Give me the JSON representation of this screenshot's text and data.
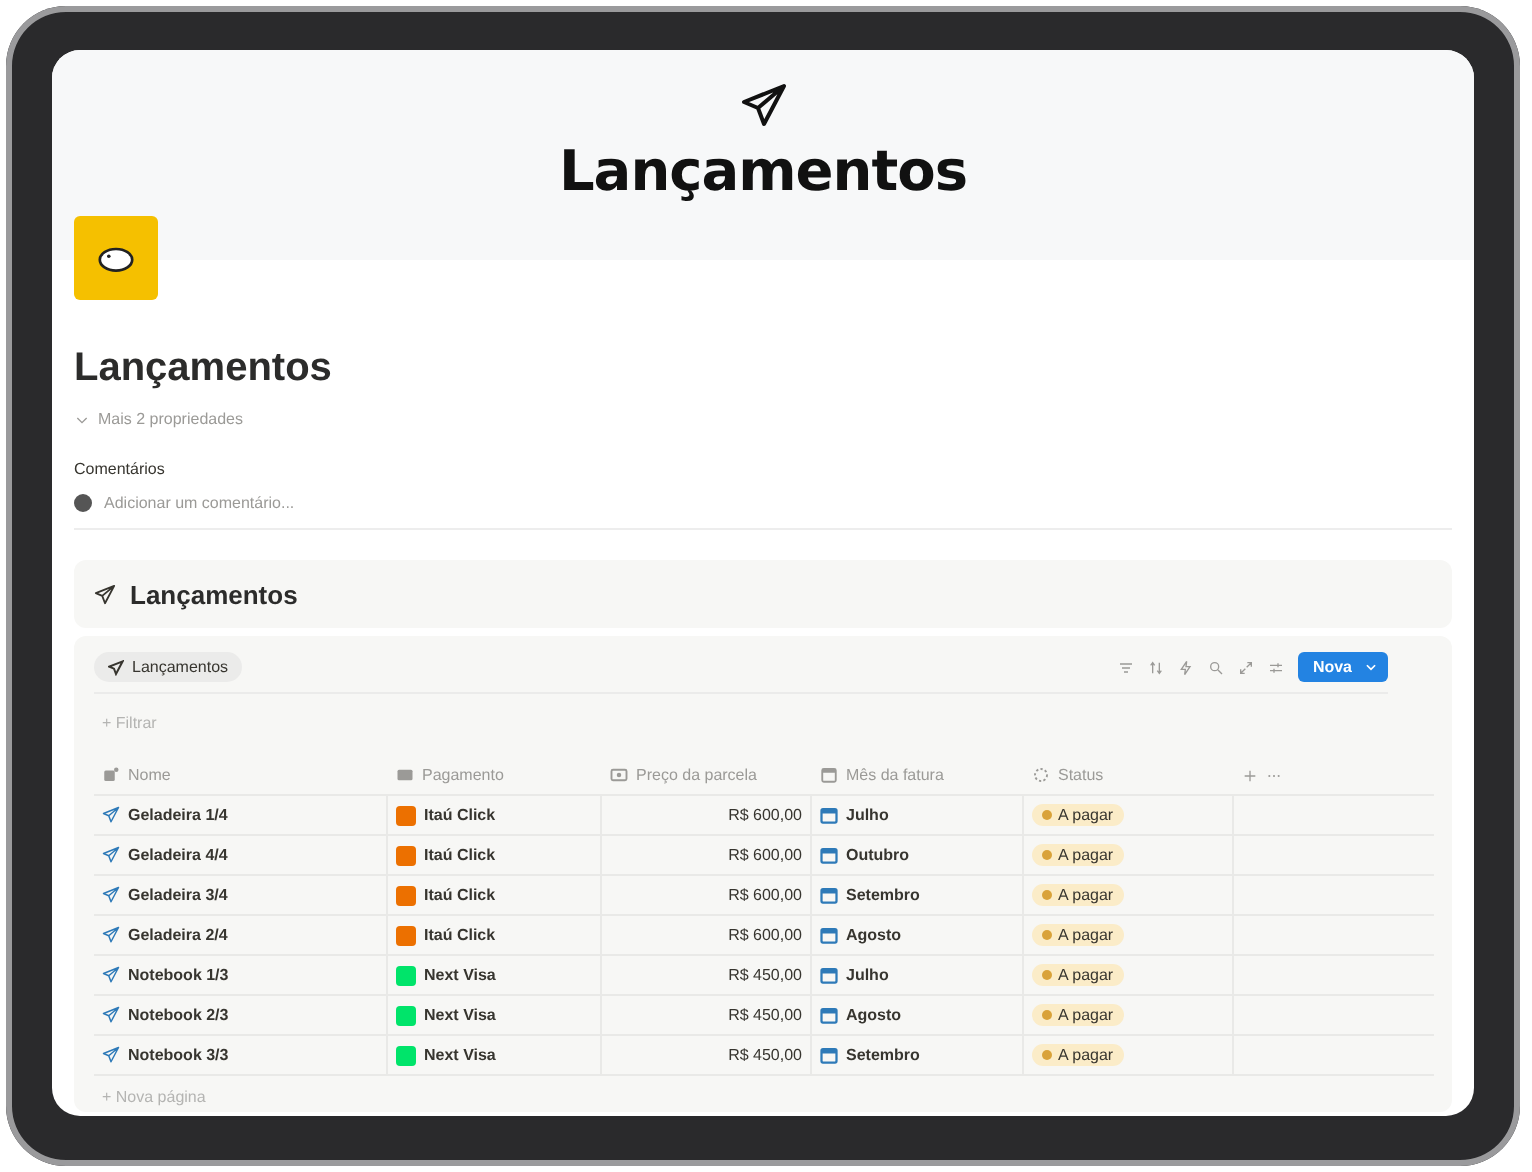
{
  "cover": {
    "title": "Lançamentos"
  },
  "page": {
    "title": "Lançamentos",
    "more_properties": "Mais 2 propriedades",
    "comments_label": "Comentários",
    "comment_placeholder": "Adicionar um comentário..."
  },
  "database": {
    "title": "Lançamentos",
    "view_tab": "Lançamentos",
    "filter": "+ Filtrar",
    "new_button": "Nova",
    "columns": [
      "Nome",
      "Pagamento",
      "Preço da parcela",
      "Mês da fatura",
      "Status"
    ],
    "rows": [
      {
        "name": "Geladeira 1/4",
        "payment": {
          "label": "Itaú Click",
          "color": "#ec7000"
        },
        "price": "R$ 600,00",
        "month": "Julho",
        "status": {
          "label": "A pagar",
          "color": "#d9a23a"
        }
      },
      {
        "name": "Geladeira 4/4",
        "payment": {
          "label": "Itaú Click",
          "color": "#ec7000"
        },
        "price": "R$ 600,00",
        "month": "Outubro",
        "status": {
          "label": "A pagar",
          "color": "#d9a23a"
        }
      },
      {
        "name": "Geladeira 3/4",
        "payment": {
          "label": "Itaú Click",
          "color": "#ec7000"
        },
        "price": "R$ 600,00",
        "month": "Setembro",
        "status": {
          "label": "A pagar",
          "color": "#d9a23a"
        }
      },
      {
        "name": "Geladeira 2/4",
        "payment": {
          "label": "Itaú Click",
          "color": "#ec7000"
        },
        "price": "R$ 600,00",
        "month": "Agosto",
        "status": {
          "label": "A pagar",
          "color": "#d9a23a"
        }
      },
      {
        "name": "Notebook 1/3",
        "payment": {
          "label": "Next Visa",
          "color": "#00e46a"
        },
        "price": "R$ 450,00",
        "month": "Julho",
        "status": {
          "label": "A pagar",
          "color": "#d9a23a"
        }
      },
      {
        "name": "Notebook 2/3",
        "payment": {
          "label": "Next Visa",
          "color": "#00e46a"
        },
        "price": "R$ 450,00",
        "month": "Agosto",
        "status": {
          "label": "A pagar",
          "color": "#d9a23a"
        }
      },
      {
        "name": "Notebook 3/3",
        "payment": {
          "label": "Next Visa",
          "color": "#00e46a"
        },
        "price": "R$ 450,00",
        "month": "Setembro",
        "status": {
          "label": "A pagar",
          "color": "#d9a23a"
        }
      }
    ],
    "new_page": "+ Nova página"
  }
}
